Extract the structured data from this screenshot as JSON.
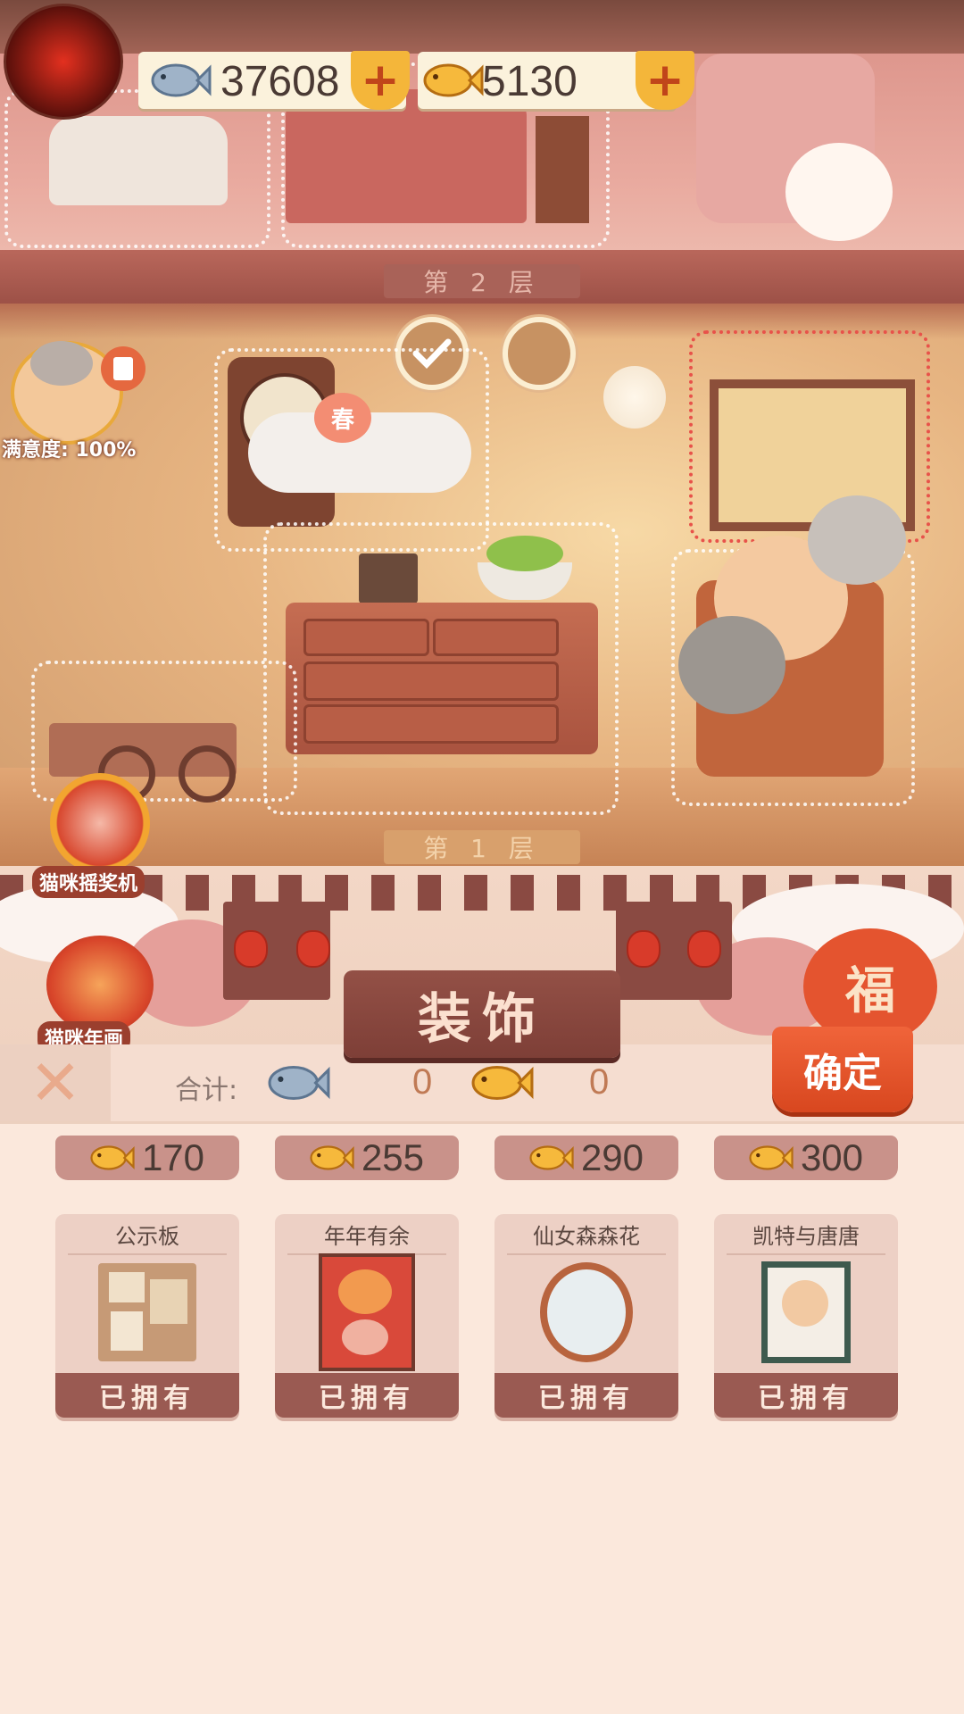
{
  "currency": {
    "silver_fish": "37608",
    "gold_fish": "5130",
    "plus": "+"
  },
  "floors": {
    "floor2_label": "第 2 层",
    "floor1_label": "第 1 层"
  },
  "satisfaction": {
    "label": "满意度: 100%"
  },
  "side_buttons": {
    "claw_machine": "猫咪摇奖机",
    "new_year_painting": "猫咪年画"
  },
  "lantern_text": "福",
  "peach_text": "春",
  "panel": {
    "title": "装饰",
    "close": "✕",
    "total_label": "合计:",
    "silver_total": "0",
    "gold_total": "0",
    "confirm": "确定"
  },
  "items": [
    {
      "price": "170",
      "name": "公示板",
      "status": "已拥有"
    },
    {
      "price": "255",
      "name": "年年有余",
      "status": "已拥有"
    },
    {
      "price": "290",
      "name": "仙女森森花",
      "status": "已拥有"
    },
    {
      "price": "300",
      "name": "凯特与唐唐",
      "status": "已拥有"
    }
  ],
  "colors": {
    "accent": "#d8471f",
    "gold": "#f4b63a",
    "panel_bg": "#fbe8dc",
    "title_plate": "#7e3f37"
  }
}
